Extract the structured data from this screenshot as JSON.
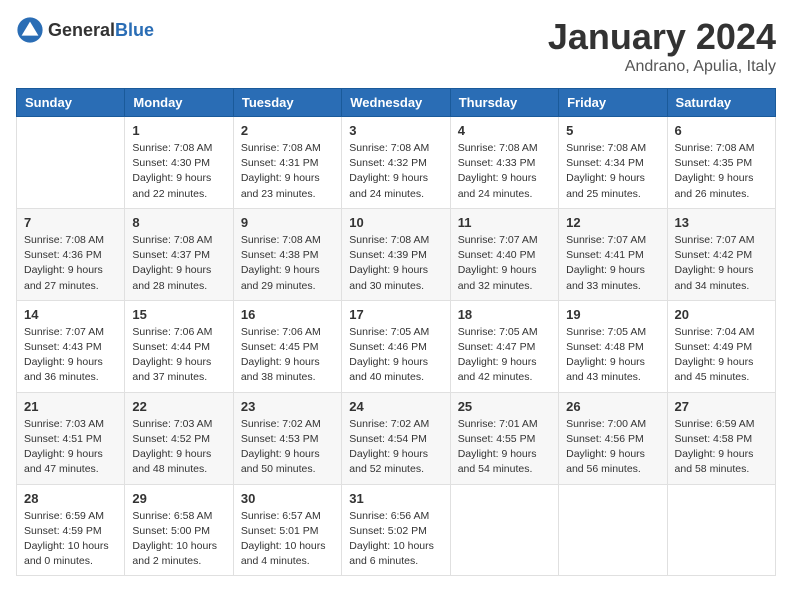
{
  "header": {
    "logo_general": "General",
    "logo_blue": "Blue",
    "title": "January 2024",
    "subtitle": "Andrano, Apulia, Italy"
  },
  "weekdays": [
    "Sunday",
    "Monday",
    "Tuesday",
    "Wednesday",
    "Thursday",
    "Friday",
    "Saturday"
  ],
  "weeks": [
    [
      {
        "day": "",
        "sunrise": "",
        "sunset": "",
        "daylight": ""
      },
      {
        "day": "1",
        "sunrise": "Sunrise: 7:08 AM",
        "sunset": "Sunset: 4:30 PM",
        "daylight": "Daylight: 9 hours and 22 minutes."
      },
      {
        "day": "2",
        "sunrise": "Sunrise: 7:08 AM",
        "sunset": "Sunset: 4:31 PM",
        "daylight": "Daylight: 9 hours and 23 minutes."
      },
      {
        "day": "3",
        "sunrise": "Sunrise: 7:08 AM",
        "sunset": "Sunset: 4:32 PM",
        "daylight": "Daylight: 9 hours and 24 minutes."
      },
      {
        "day": "4",
        "sunrise": "Sunrise: 7:08 AM",
        "sunset": "Sunset: 4:33 PM",
        "daylight": "Daylight: 9 hours and 24 minutes."
      },
      {
        "day": "5",
        "sunrise": "Sunrise: 7:08 AM",
        "sunset": "Sunset: 4:34 PM",
        "daylight": "Daylight: 9 hours and 25 minutes."
      },
      {
        "day": "6",
        "sunrise": "Sunrise: 7:08 AM",
        "sunset": "Sunset: 4:35 PM",
        "daylight": "Daylight: 9 hours and 26 minutes."
      }
    ],
    [
      {
        "day": "7",
        "sunrise": "Sunrise: 7:08 AM",
        "sunset": "Sunset: 4:36 PM",
        "daylight": "Daylight: 9 hours and 27 minutes."
      },
      {
        "day": "8",
        "sunrise": "Sunrise: 7:08 AM",
        "sunset": "Sunset: 4:37 PM",
        "daylight": "Daylight: 9 hours and 28 minutes."
      },
      {
        "day": "9",
        "sunrise": "Sunrise: 7:08 AM",
        "sunset": "Sunset: 4:38 PM",
        "daylight": "Daylight: 9 hours and 29 minutes."
      },
      {
        "day": "10",
        "sunrise": "Sunrise: 7:08 AM",
        "sunset": "Sunset: 4:39 PM",
        "daylight": "Daylight: 9 hours and 30 minutes."
      },
      {
        "day": "11",
        "sunrise": "Sunrise: 7:07 AM",
        "sunset": "Sunset: 4:40 PM",
        "daylight": "Daylight: 9 hours and 32 minutes."
      },
      {
        "day": "12",
        "sunrise": "Sunrise: 7:07 AM",
        "sunset": "Sunset: 4:41 PM",
        "daylight": "Daylight: 9 hours and 33 minutes."
      },
      {
        "day": "13",
        "sunrise": "Sunrise: 7:07 AM",
        "sunset": "Sunset: 4:42 PM",
        "daylight": "Daylight: 9 hours and 34 minutes."
      }
    ],
    [
      {
        "day": "14",
        "sunrise": "Sunrise: 7:07 AM",
        "sunset": "Sunset: 4:43 PM",
        "daylight": "Daylight: 9 hours and 36 minutes."
      },
      {
        "day": "15",
        "sunrise": "Sunrise: 7:06 AM",
        "sunset": "Sunset: 4:44 PM",
        "daylight": "Daylight: 9 hours and 37 minutes."
      },
      {
        "day": "16",
        "sunrise": "Sunrise: 7:06 AM",
        "sunset": "Sunset: 4:45 PM",
        "daylight": "Daylight: 9 hours and 38 minutes."
      },
      {
        "day": "17",
        "sunrise": "Sunrise: 7:05 AM",
        "sunset": "Sunset: 4:46 PM",
        "daylight": "Daylight: 9 hours and 40 minutes."
      },
      {
        "day": "18",
        "sunrise": "Sunrise: 7:05 AM",
        "sunset": "Sunset: 4:47 PM",
        "daylight": "Daylight: 9 hours and 42 minutes."
      },
      {
        "day": "19",
        "sunrise": "Sunrise: 7:05 AM",
        "sunset": "Sunset: 4:48 PM",
        "daylight": "Daylight: 9 hours and 43 minutes."
      },
      {
        "day": "20",
        "sunrise": "Sunrise: 7:04 AM",
        "sunset": "Sunset: 4:49 PM",
        "daylight": "Daylight: 9 hours and 45 minutes."
      }
    ],
    [
      {
        "day": "21",
        "sunrise": "Sunrise: 7:03 AM",
        "sunset": "Sunset: 4:51 PM",
        "daylight": "Daylight: 9 hours and 47 minutes."
      },
      {
        "day": "22",
        "sunrise": "Sunrise: 7:03 AM",
        "sunset": "Sunset: 4:52 PM",
        "daylight": "Daylight: 9 hours and 48 minutes."
      },
      {
        "day": "23",
        "sunrise": "Sunrise: 7:02 AM",
        "sunset": "Sunset: 4:53 PM",
        "daylight": "Daylight: 9 hours and 50 minutes."
      },
      {
        "day": "24",
        "sunrise": "Sunrise: 7:02 AM",
        "sunset": "Sunset: 4:54 PM",
        "daylight": "Daylight: 9 hours and 52 minutes."
      },
      {
        "day": "25",
        "sunrise": "Sunrise: 7:01 AM",
        "sunset": "Sunset: 4:55 PM",
        "daylight": "Daylight: 9 hours and 54 minutes."
      },
      {
        "day": "26",
        "sunrise": "Sunrise: 7:00 AM",
        "sunset": "Sunset: 4:56 PM",
        "daylight": "Daylight: 9 hours and 56 minutes."
      },
      {
        "day": "27",
        "sunrise": "Sunrise: 6:59 AM",
        "sunset": "Sunset: 4:58 PM",
        "daylight": "Daylight: 9 hours and 58 minutes."
      }
    ],
    [
      {
        "day": "28",
        "sunrise": "Sunrise: 6:59 AM",
        "sunset": "Sunset: 4:59 PM",
        "daylight": "Daylight: 10 hours and 0 minutes."
      },
      {
        "day": "29",
        "sunrise": "Sunrise: 6:58 AM",
        "sunset": "Sunset: 5:00 PM",
        "daylight": "Daylight: 10 hours and 2 minutes."
      },
      {
        "day": "30",
        "sunrise": "Sunrise: 6:57 AM",
        "sunset": "Sunset: 5:01 PM",
        "daylight": "Daylight: 10 hours and 4 minutes."
      },
      {
        "day": "31",
        "sunrise": "Sunrise: 6:56 AM",
        "sunset": "Sunset: 5:02 PM",
        "daylight": "Daylight: 10 hours and 6 minutes."
      },
      {
        "day": "",
        "sunrise": "",
        "sunset": "",
        "daylight": ""
      },
      {
        "day": "",
        "sunrise": "",
        "sunset": "",
        "daylight": ""
      },
      {
        "day": "",
        "sunrise": "",
        "sunset": "",
        "daylight": ""
      }
    ]
  ]
}
